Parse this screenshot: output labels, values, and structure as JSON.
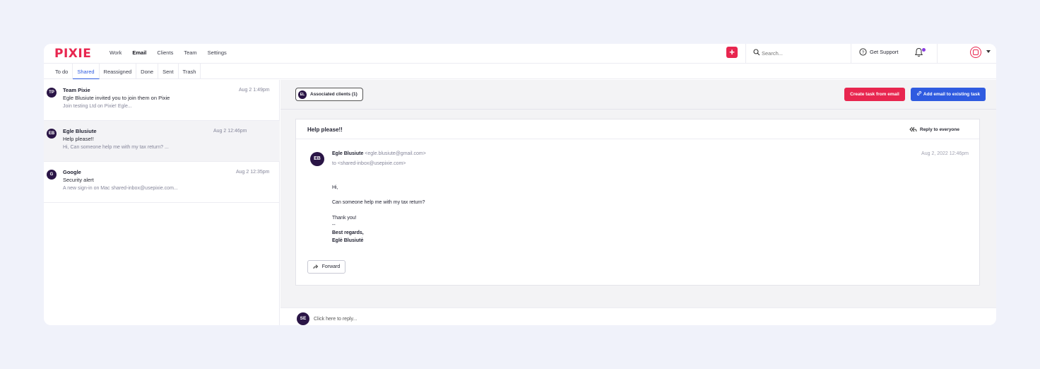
{
  "brand": {
    "logo": "PIXIE",
    "accent": "#e8264f",
    "primary": "#2f5be0"
  },
  "nav": {
    "items": [
      "Work",
      "Email",
      "Clients",
      "Team",
      "Settings"
    ],
    "active": "Email"
  },
  "header": {
    "add_label": "+",
    "search_placeholder": "Search...",
    "support_label": "Get Support",
    "icons": [
      "search-icon",
      "help-circle-icon",
      "bell-icon",
      "user-avatar-icon",
      "chevron-down-icon"
    ]
  },
  "tabs": {
    "items": [
      "To do",
      "Shared",
      "Reassigned",
      "Done",
      "Sent",
      "Trash"
    ],
    "active": "Shared"
  },
  "emails": [
    {
      "initials": "TP",
      "from": "Team Pixie",
      "subject": "Egle Blusiute invited you to join them on Pixie",
      "preview": "Join testing Ltd on Pixie! Egle...",
      "date": "Aug 2 1:49pm"
    },
    {
      "initials": "EB",
      "from": "Egle Blusiute",
      "subject": "Help please!!",
      "preview": "Hi, Can someone help me with my tax return? ...",
      "date": "Aug 2 12:46pm"
    },
    {
      "initials": "G",
      "from": "Google",
      "subject": "Security alert",
      "preview": "A new sign-in on Mac shared-inbox@usepixie.com...",
      "date": "Aug 2 12:35pm"
    }
  ],
  "detail": {
    "assoc_initials": "EL",
    "assoc_label": "Associated clients (1)",
    "create_task_label": "Create task from email",
    "add_existing_label": "Add email to existing task",
    "title": "Help please!!",
    "reply_all_label": "Reply to everyone",
    "sender_initials": "EB",
    "sender_name": "Egle Blusiute",
    "sender_email": "<egle.blusiute@gmail.com>",
    "to_line": "to <shared-inbox@usepixie.com>",
    "date": "Aug 2, 2022 12:46pm",
    "body": {
      "greeting": "Hi,",
      "line1": "Can someone help me with my tax return?",
      "thanks": "Thank you!",
      "sep": "--",
      "regards": "Best regards,",
      "sign": "Eglė Blusiutė"
    },
    "forward_label": "Forward"
  },
  "reply": {
    "initials": "SE",
    "placeholder": "Click here to reply..."
  }
}
